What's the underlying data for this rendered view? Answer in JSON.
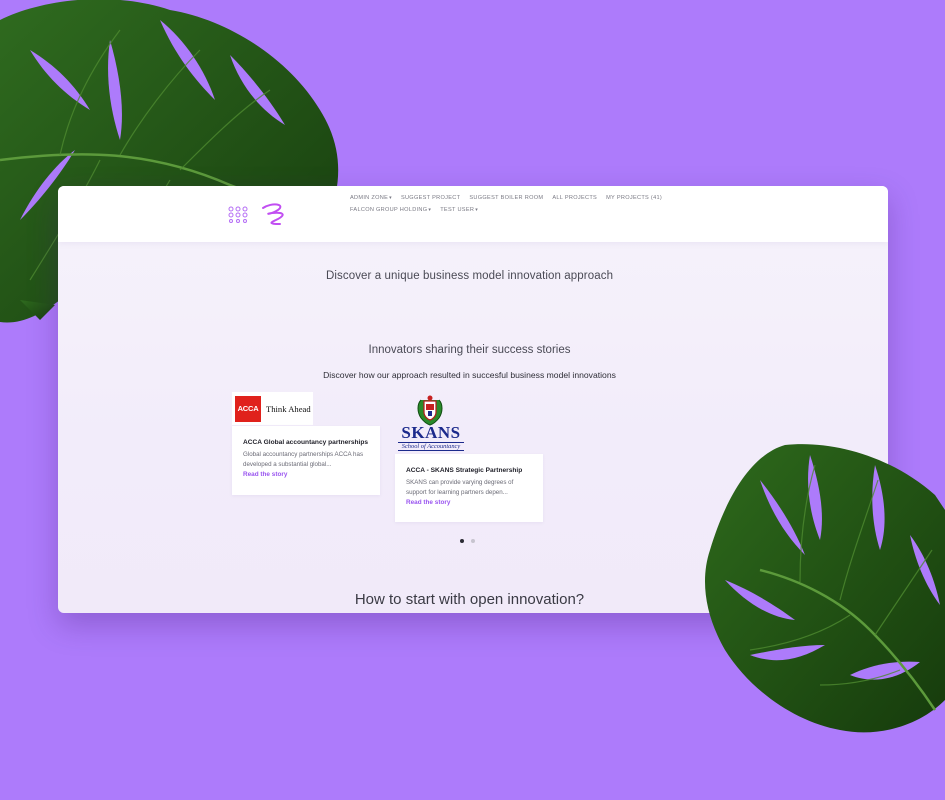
{
  "nav": {
    "items": [
      {
        "label": "ADMIN ZONE",
        "caret": "▾"
      },
      {
        "label": "SUGGEST PROJECT",
        "caret": ""
      },
      {
        "label": "SUGGEST BOILER ROOM",
        "caret": ""
      },
      {
        "label": "ALL PROJECTS",
        "caret": ""
      },
      {
        "label": "MY PROJECTS (41)",
        "caret": ""
      },
      {
        "label": "FALCON GROUP HOLDING",
        "caret": "▾"
      },
      {
        "label": "TEST USER",
        "caret": "▾"
      }
    ]
  },
  "hero": {
    "title": "Discover a unique business model innovation approach"
  },
  "stories": {
    "title": "Innovators sharing their success stories",
    "subtitle": "Discover how our approach resulted in succesful business model innovations",
    "cards": [
      {
        "logo_mark": "ACCA",
        "logo_tagline": "Think Ahead",
        "title": "ACCA Global accountancy partnerships",
        "text": "Global accountancy partnerships ACCA has developed a substantial global...",
        "link": "Read the story"
      },
      {
        "logo_mark": "SKANS",
        "logo_tagline": "School of Accountancy",
        "title": "ACCA - SKANS Strategic Partnership",
        "text": "SKANS can provide varying degrees of support for learning partners depen...",
        "link": "Read the story"
      }
    ],
    "carousel": {
      "pages": 2,
      "active": 1
    }
  },
  "open_innovation": {
    "title": "How to start with open innovation?"
  },
  "colors": {
    "background": "#ad7bfb",
    "accent": "#9a55f0",
    "acca_red": "#e0211c",
    "skans_blue": "#1c2a8c"
  }
}
